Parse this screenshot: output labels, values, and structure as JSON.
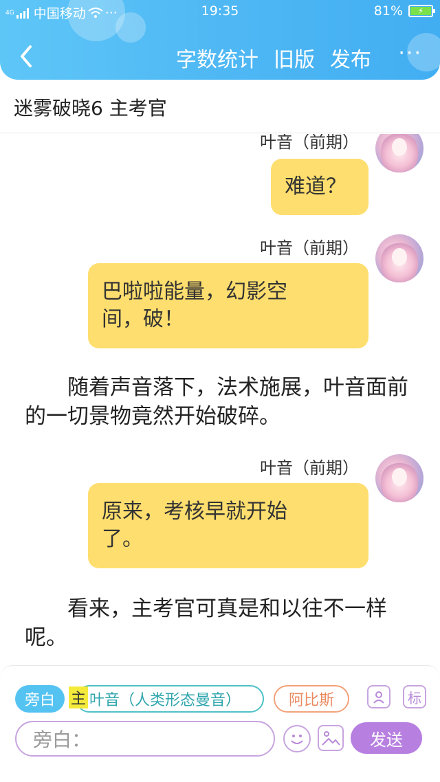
{
  "status_bar": {
    "network": "4G",
    "carrier": "中国移动",
    "dots": "···",
    "time": "19:35",
    "battery": "81%"
  },
  "nav": {
    "actions": [
      "字数统计",
      "旧版",
      "发布"
    ],
    "more": "···"
  },
  "story_title": "迷雾破晓6 主考官",
  "messages": [
    {
      "type": "dialog",
      "speaker": "叶音（前期）",
      "lines": [
        "难道？"
      ]
    },
    {
      "type": "dialog",
      "speaker": "叶音（前期）",
      "lines": [
        "巴啦啦能量，幻影空",
        "间，破！"
      ]
    },
    {
      "type": "narration",
      "text": "随着声音落下，法术施展，叶音面前的一切景物竟然开始破碎。"
    },
    {
      "type": "dialog",
      "speaker": "叶音（前期）",
      "lines": [
        "原来，考核早就开始",
        "了。"
      ]
    },
    {
      "type": "narration",
      "text": "看来，主考官可真是和以往不一样呢。"
    }
  ],
  "composer": {
    "narration_chip": "旁白",
    "main_marker": "主",
    "role_chip": "叶音（人类形态曼音）",
    "role_chip_2": "阿比斯",
    "character_icon": "person-icon",
    "tag_icon_label": "标",
    "input_placeholder": "旁白：",
    "send_label": "发送"
  },
  "colors": {
    "header": "#4fb8f4",
    "bubble": "#fede6e",
    "accent": "#b77fe0",
    "narration_chip": "#55c3f1"
  }
}
